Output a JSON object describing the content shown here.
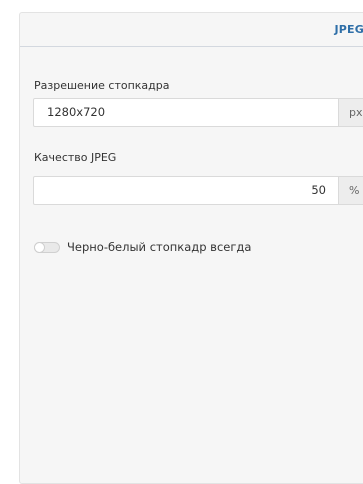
{
  "header": {
    "tab_title": "JPEG"
  },
  "resolution": {
    "label": "Разрешение стопкадра",
    "value": "1280x720",
    "unit": "px"
  },
  "quality": {
    "label": "Качество JPEG",
    "value": "50",
    "unit": "%"
  },
  "grayscale": {
    "label": "Черно-белый стопкадр всегда",
    "enabled": false
  }
}
